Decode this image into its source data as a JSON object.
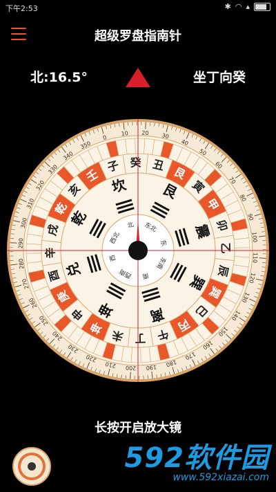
{
  "status": {
    "time": "下午2:53"
  },
  "app": {
    "title": "超级罗盘指南针"
  },
  "heading": {
    "label": "北:16.5°"
  },
  "sitting": {
    "label": "坐丁向癸"
  },
  "hint": "长按开启放大镜",
  "watermark": {
    "logo_num": "592",
    "logo_text": "软件园",
    "url": "www.592xiazai.com"
  },
  "compass": {
    "rotation_deg": -16.5,
    "degree_labels": [
      "0",
      "10",
      "20",
      "30",
      "40",
      "50",
      "60",
      "70",
      "80",
      "90",
      "100",
      "110",
      "120",
      "130",
      "140",
      "150",
      "160",
      "170",
      "180",
      "190",
      "200",
      "210",
      "220",
      "230",
      "240",
      "250",
      "260",
      "270",
      "280",
      "290",
      "300",
      "310",
      "320",
      "330",
      "340",
      "350"
    ],
    "mountains": [
      "子",
      "癸",
      "丑",
      "艮",
      "寅",
      "甲",
      "卯",
      "乙",
      "辰",
      "巽",
      "巳",
      "丙",
      "午",
      "丁",
      "未",
      "坤",
      "申",
      "庚",
      "酉",
      "辛",
      "戌",
      "乾",
      "亥",
      "壬"
    ],
    "trigram_names": [
      "坎",
      "艮",
      "震",
      "巽",
      "离",
      "坤",
      "兑",
      "乾"
    ],
    "inner_dirs": [
      "北",
      "东北",
      "东",
      "东南",
      "南",
      "西南",
      "西",
      "西北"
    ],
    "colors": {
      "accent": "#e8562a",
      "ring": "#f6ead6",
      "rim": "#d9a56a",
      "needle": "#d91f2a"
    }
  }
}
